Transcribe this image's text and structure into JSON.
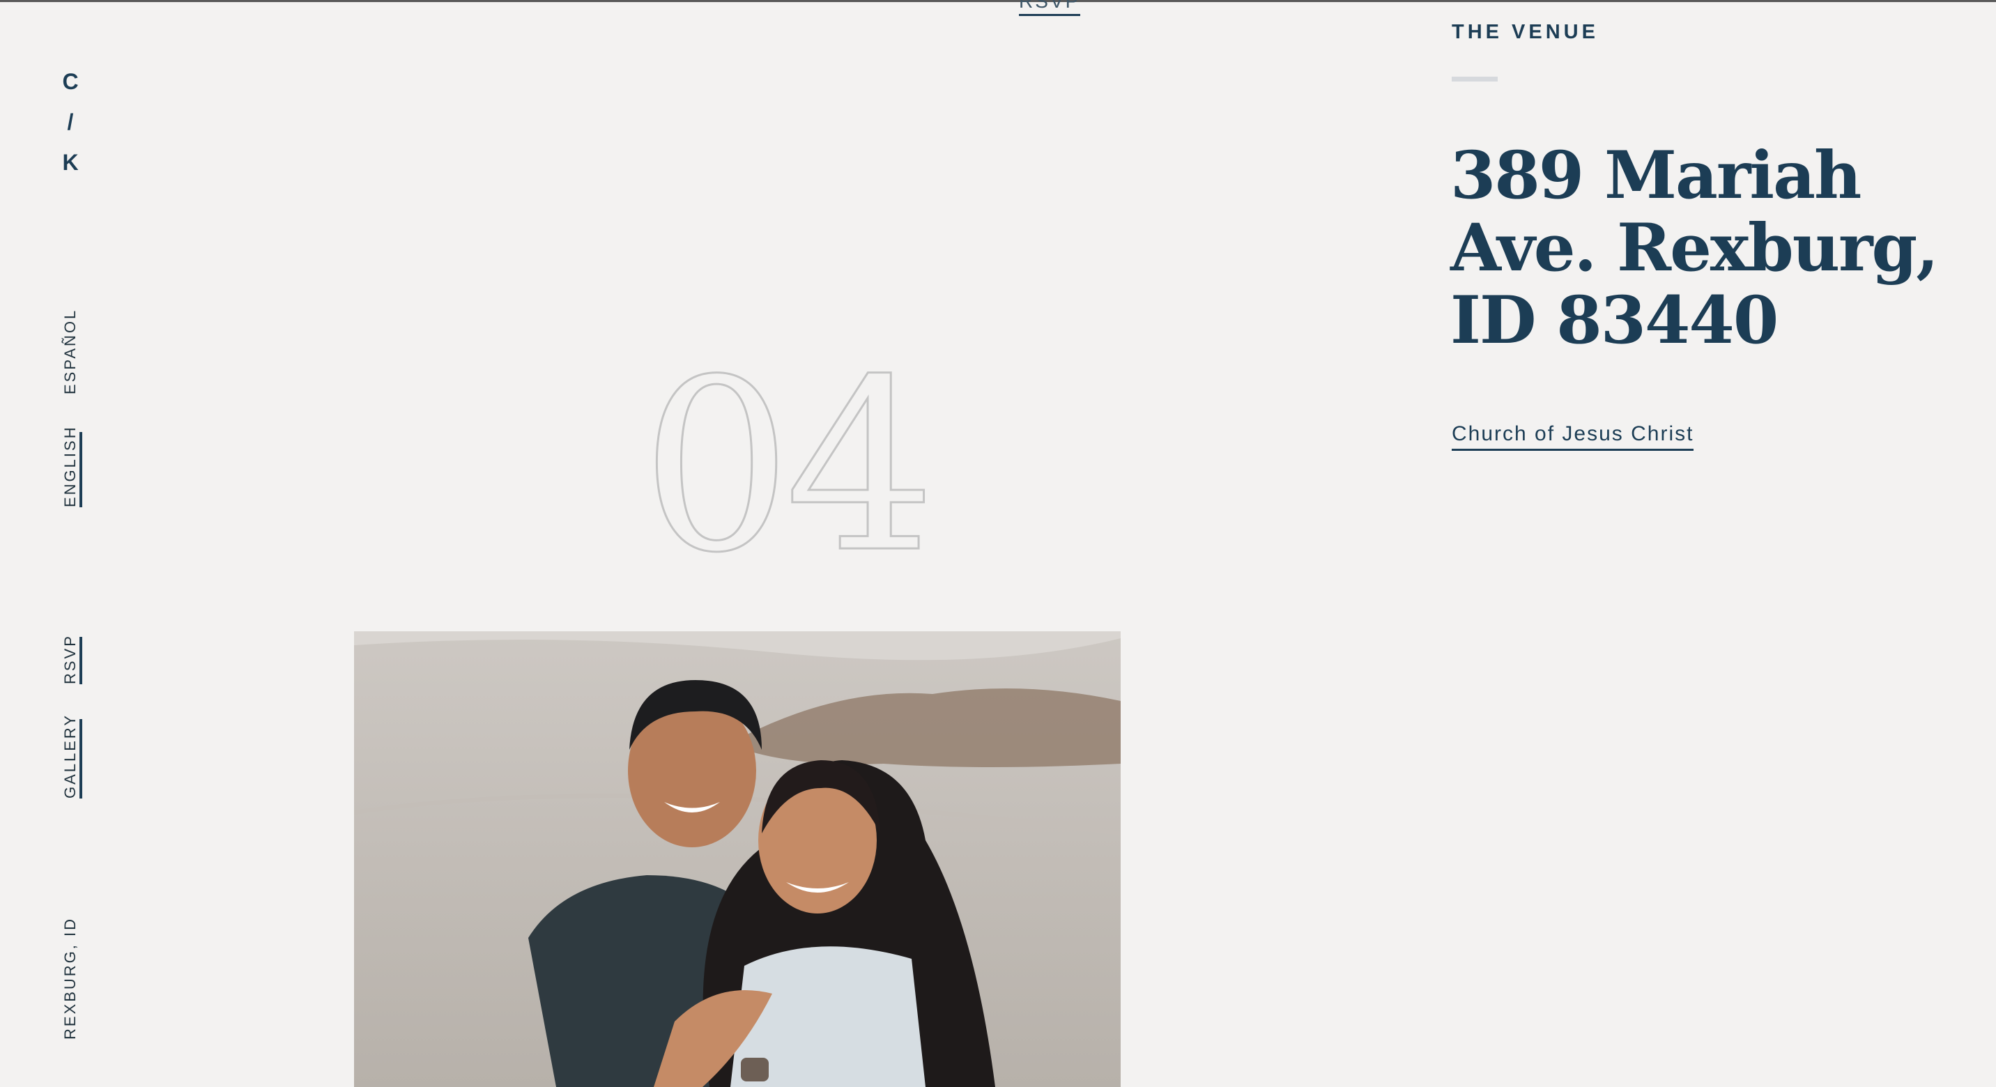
{
  "brand": {
    "monogram": [
      "C",
      "/",
      "K"
    ]
  },
  "nav": {
    "languages": {
      "spanish": "ESPAÑOL",
      "english": "ENGLISH"
    },
    "links": {
      "rsvp": "RSVP",
      "gallery": "GALLERY"
    },
    "location": "REXBURG, ID"
  },
  "header": {
    "rsvp_link": "RSVP"
  },
  "section": {
    "number": "04",
    "label": "THE VENUE",
    "address_lines": [
      "389 Mariah",
      "Ave. Rexburg,",
      "ID 83440"
    ],
    "venue_link": "Church of Jesus Christ"
  },
  "colors": {
    "accent": "#1c3d55",
    "background": "#f3f2f1",
    "number_outline": "#c4c4c4"
  }
}
